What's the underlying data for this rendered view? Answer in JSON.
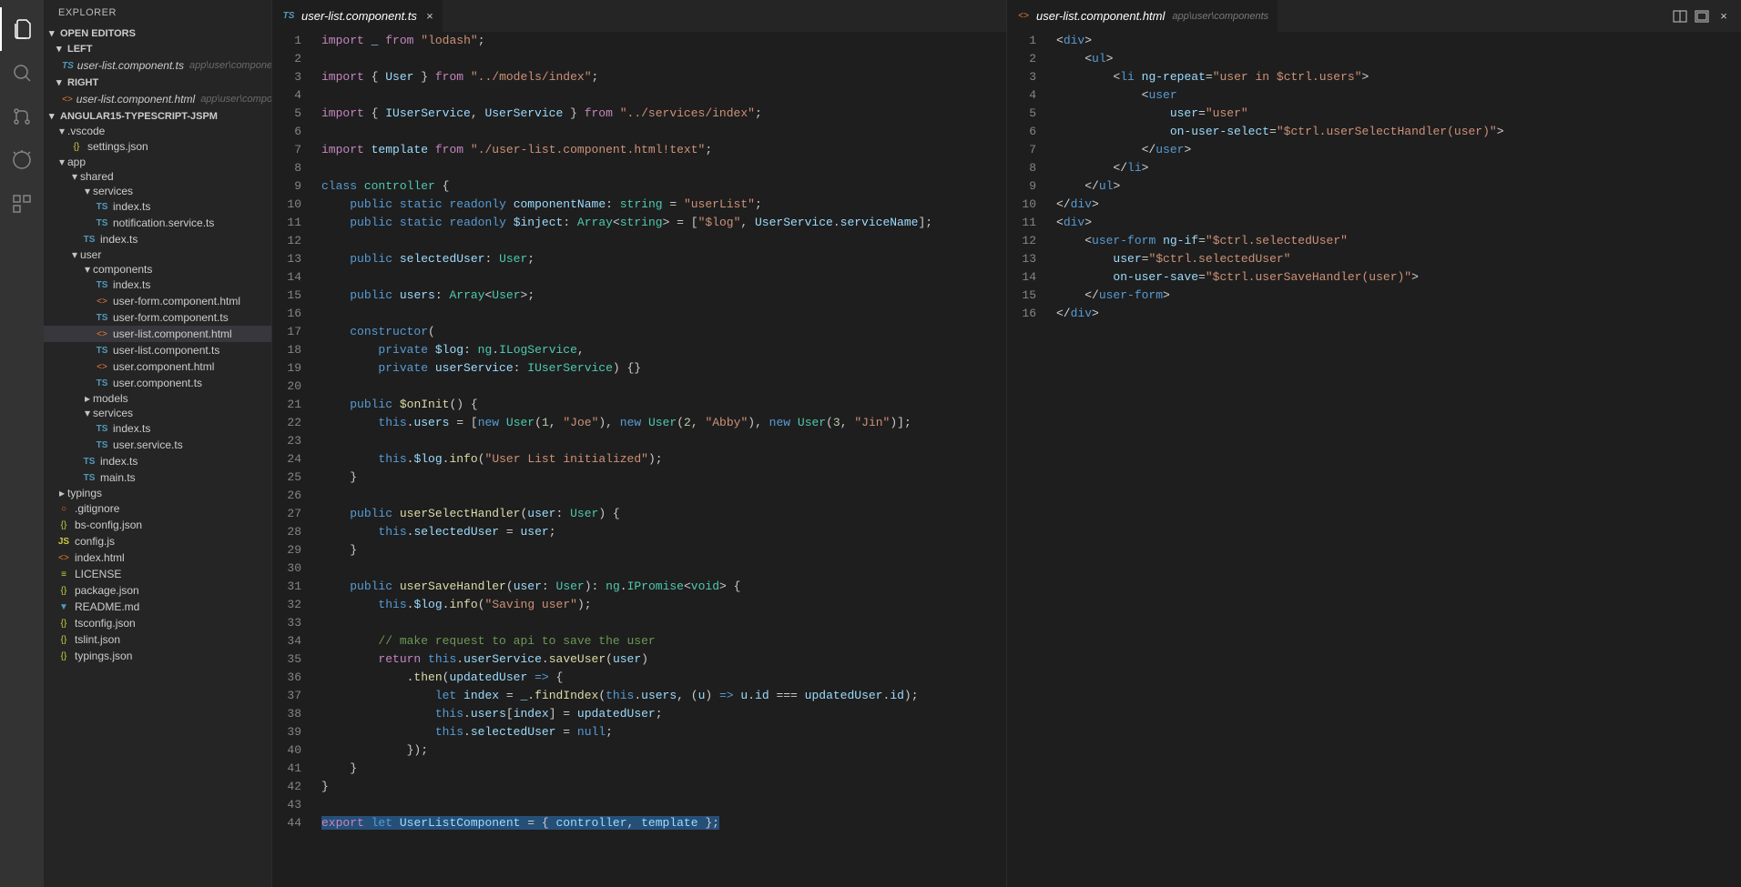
{
  "sidebar": {
    "title": "EXPLORER",
    "sections": {
      "openEditors": "OPEN EDITORS",
      "left": "LEFT",
      "right": "RIGHT",
      "project": "ANGULAR15-TYPESCRIPT-JSPM"
    },
    "openEditorLeft": {
      "name": "user-list.component.ts",
      "path": "app\\user\\components"
    },
    "openEditorRight": {
      "name": "user-list.component.html",
      "path": "app\\user\\compon..."
    },
    "tree": [
      {
        "depth": 0,
        "type": "folder",
        "name": ".vscode",
        "open": true
      },
      {
        "depth": 1,
        "type": "file",
        "name": "settings.json",
        "icon": "json"
      },
      {
        "depth": 0,
        "type": "folder",
        "name": "app",
        "open": true
      },
      {
        "depth": 1,
        "type": "folder",
        "name": "shared",
        "open": true
      },
      {
        "depth": 2,
        "type": "folder",
        "name": "services",
        "open": true
      },
      {
        "depth": 3,
        "type": "file",
        "name": "index.ts",
        "icon": "ts"
      },
      {
        "depth": 3,
        "type": "file",
        "name": "notification.service.ts",
        "icon": "ts"
      },
      {
        "depth": 2,
        "type": "file",
        "name": "index.ts",
        "icon": "ts"
      },
      {
        "depth": 1,
        "type": "folder",
        "name": "user",
        "open": true
      },
      {
        "depth": 2,
        "type": "folder",
        "name": "components",
        "open": true
      },
      {
        "depth": 3,
        "type": "file",
        "name": "index.ts",
        "icon": "ts"
      },
      {
        "depth": 3,
        "type": "file",
        "name": "user-form.component.html",
        "icon": "html"
      },
      {
        "depth": 3,
        "type": "file",
        "name": "user-form.component.ts",
        "icon": "ts"
      },
      {
        "depth": 3,
        "type": "file",
        "name": "user-list.component.html",
        "icon": "html",
        "selected": true
      },
      {
        "depth": 3,
        "type": "file",
        "name": "user-list.component.ts",
        "icon": "ts"
      },
      {
        "depth": 3,
        "type": "file",
        "name": "user.component.html",
        "icon": "html"
      },
      {
        "depth": 3,
        "type": "file",
        "name": "user.component.ts",
        "icon": "ts"
      },
      {
        "depth": 2,
        "type": "folder",
        "name": "models",
        "open": false
      },
      {
        "depth": 2,
        "type": "folder",
        "name": "services",
        "open": true
      },
      {
        "depth": 3,
        "type": "file",
        "name": "index.ts",
        "icon": "ts"
      },
      {
        "depth": 3,
        "type": "file",
        "name": "user.service.ts",
        "icon": "ts"
      },
      {
        "depth": 2,
        "type": "file",
        "name": "index.ts",
        "icon": "ts"
      },
      {
        "depth": 2,
        "type": "file",
        "name": "main.ts",
        "icon": "ts"
      },
      {
        "depth": 0,
        "type": "folder",
        "name": "typings",
        "open": false
      },
      {
        "depth": 0,
        "type": "file",
        "name": ".gitignore",
        "icon": "git"
      },
      {
        "depth": 0,
        "type": "file",
        "name": "bs-config.json",
        "icon": "json"
      },
      {
        "depth": 0,
        "type": "file",
        "name": "config.js",
        "icon": "js"
      },
      {
        "depth": 0,
        "type": "file",
        "name": "index.html",
        "icon": "html"
      },
      {
        "depth": 0,
        "type": "file",
        "name": "LICENSE",
        "icon": "txt"
      },
      {
        "depth": 0,
        "type": "file",
        "name": "package.json",
        "icon": "json"
      },
      {
        "depth": 0,
        "type": "file",
        "name": "README.md",
        "icon": "md"
      },
      {
        "depth": 0,
        "type": "file",
        "name": "tsconfig.json",
        "icon": "json"
      },
      {
        "depth": 0,
        "type": "file",
        "name": "tslint.json",
        "icon": "json"
      },
      {
        "depth": 0,
        "type": "file",
        "name": "typings.json",
        "icon": "json"
      }
    ]
  },
  "leftEditor": {
    "tab": {
      "name": "user-list.component.ts",
      "icon": "ts"
    },
    "lines": [
      "<span class='kw2'>import</span> <span class='var'>_</span> <span class='kw2'>from</span> <span class='str'>\"lodash\"</span>;",
      "",
      "<span class='kw2'>import</span> { <span class='var'>User</span> } <span class='kw2'>from</span> <span class='str'>\"../models/index\"</span>;",
      "",
      "<span class='kw2'>import</span> { <span class='var'>IUserService</span>, <span class='var'>UserService</span> } <span class='kw2'>from</span> <span class='str'>\"../services/index\"</span>;",
      "",
      "<span class='kw2'>import</span> <span class='var'>template</span> <span class='kw2'>from</span> <span class='str'>\"./user-list.component.html!text\"</span>;",
      "",
      "<span class='kw'>class</span> <span class='cls'>controller</span> {",
      "    <span class='kw'>public</span> <span class='kw'>static</span> <span class='kw'>readonly</span> <span class='var'>componentName</span>: <span class='cls'>string</span> = <span class='str'>\"userList\"</span>;",
      "    <span class='kw'>public</span> <span class='kw'>static</span> <span class='kw'>readonly</span> <span class='var'>$inject</span>: <span class='cls'>Array</span>&lt;<span class='cls'>string</span>&gt; = [<span class='str'>\"$log\"</span>, <span class='var'>UserService</span>.<span class='var'>serviceName</span>];",
      "",
      "    <span class='kw'>public</span> <span class='var'>selectedUser</span>: <span class='cls'>User</span>;",
      "",
      "    <span class='kw'>public</span> <span class='var'>users</span>: <span class='cls'>Array</span>&lt;<span class='cls'>User</span>&gt;;",
      "",
      "    <span class='kw'>constructor</span>(",
      "        <span class='kw'>private</span> <span class='var'>$log</span>: <span class='cls'>ng</span>.<span class='cls'>ILogService</span>,",
      "        <span class='kw'>private</span> <span class='var'>userService</span>: <span class='cls'>IUserService</span>) {}",
      "",
      "    <span class='kw'>public</span> <span class='fn'>$onInit</span>() {",
      "        <span class='kw'>this</span>.<span class='var'>users</span> = [<span class='kw'>new</span> <span class='cls'>User</span>(<span class='num'>1</span>, <span class='str'>\"Joe\"</span>), <span class='kw'>new</span> <span class='cls'>User</span>(<span class='num'>2</span>, <span class='str'>\"Abby\"</span>), <span class='kw'>new</span> <span class='cls'>User</span>(<span class='num'>3</span>, <span class='str'>\"Jin\"</span>)];",
      "",
      "        <span class='kw'>this</span>.<span class='var'>$log</span>.<span class='fn'>info</span>(<span class='str'>\"User List initialized\"</span>);",
      "    }",
      "",
      "    <span class='kw'>public</span> <span class='fn'>userSelectHandler</span>(<span class='var'>user</span>: <span class='cls'>User</span>) {",
      "        <span class='kw'>this</span>.<span class='var'>selectedUser</span> = <span class='var'>user</span>;",
      "    }",
      "",
      "    <span class='kw'>public</span> <span class='fn'>userSaveHandler</span>(<span class='var'>user</span>: <span class='cls'>User</span>): <span class='cls'>ng</span>.<span class='cls'>IPromise</span>&lt;<span class='cls'>void</span>&gt; {",
      "        <span class='kw'>this</span>.<span class='var'>$log</span>.<span class='fn'>info</span>(<span class='str'>\"Saving user\"</span>);",
      "",
      "        <span class='cmt'>// make request to api to save the user</span>",
      "        <span class='kw2'>return</span> <span class='kw'>this</span>.<span class='var'>userService</span>.<span class='fn'>saveUser</span>(<span class='var'>user</span>)",
      "            .<span class='fn'>then</span>(<span class='var'>updatedUser</span> <span class='kw'>=&gt;</span> {",
      "                <span class='kw'>let</span> <span class='var'>index</span> = <span class='var'>_</span>.<span class='fn'>findIndex</span>(<span class='kw'>this</span>.<span class='var'>users</span>, (<span class='var'>u</span>) <span class='kw'>=&gt;</span> <span class='var'>u</span>.<span class='var'>id</span> === <span class='var'>updatedUser</span>.<span class='var'>id</span>);",
      "                <span class='kw'>this</span>.<span class='var'>users</span>[<span class='var'>index</span>] = <span class='var'>updatedUser</span>;",
      "                <span class='kw'>this</span>.<span class='var'>selectedUser</span> = <span class='kw'>null</span>;",
      "            });",
      "    }",
      "}",
      "",
      "<span class='hl'><span class='kw2'>export</span> <span class='kw'>let</span> <span class='var'>UserListComponent</span> = { <span class='var'>controller</span>, <span class='var'>template</span> };</span>"
    ]
  },
  "rightEditor": {
    "tab": {
      "name": "user-list.component.html",
      "path": "app\\user\\components",
      "icon": "html"
    },
    "lines": [
      "<span class='pun'>&lt;</span><span class='tag'>div</span><span class='pun'>&gt;</span>",
      "    <span class='pun'>&lt;</span><span class='tag'>ul</span><span class='pun'>&gt;</span>",
      "        <span class='pun'>&lt;</span><span class='tag'>li</span> <span class='attr'>ng-repeat</span>=<span class='str'>\"user in $ctrl.users\"</span><span class='pun'>&gt;</span>",
      "            <span class='pun'>&lt;</span><span class='tag'>user</span>",
      "                <span class='attr'>user</span>=<span class='str'>\"user\"</span>",
      "                <span class='attr'>on-user-select</span>=<span class='str'>\"$ctrl.userSelectHandler(user)\"</span><span class='pun'>&gt;</span>",
      "            <span class='pun'>&lt;/</span><span class='tag'>user</span><span class='pun'>&gt;</span>",
      "        <span class='pun'>&lt;/</span><span class='tag'>li</span><span class='pun'>&gt;</span>",
      "    <span class='pun'>&lt;/</span><span class='tag'>ul</span><span class='pun'>&gt;</span>",
      "<span class='pun'>&lt;/</span><span class='tag'>div</span><span class='pun'>&gt;</span>",
      "<span class='pun'>&lt;</span><span class='tag'>div</span><span class='pun'>&gt;</span>",
      "    <span class='pun'>&lt;</span><span class='tag'>user-form</span> <span class='attr'>ng-if</span>=<span class='str'>\"$ctrl.selectedUser\"</span>",
      "        <span class='attr'>user</span>=<span class='str'>\"$ctrl.selectedUser\"</span>",
      "        <span class='attr'>on-user-save</span>=<span class='str'>\"$ctrl.userSaveHandler(user)\"</span><span class='pun'>&gt;</span>",
      "    <span class='pun'>&lt;/</span><span class='tag'>user-form</span><span class='pun'>&gt;</span>",
      "<span class='pun'>&lt;/</span><span class='tag'>div</span><span class='pun'>&gt;</span>"
    ]
  }
}
